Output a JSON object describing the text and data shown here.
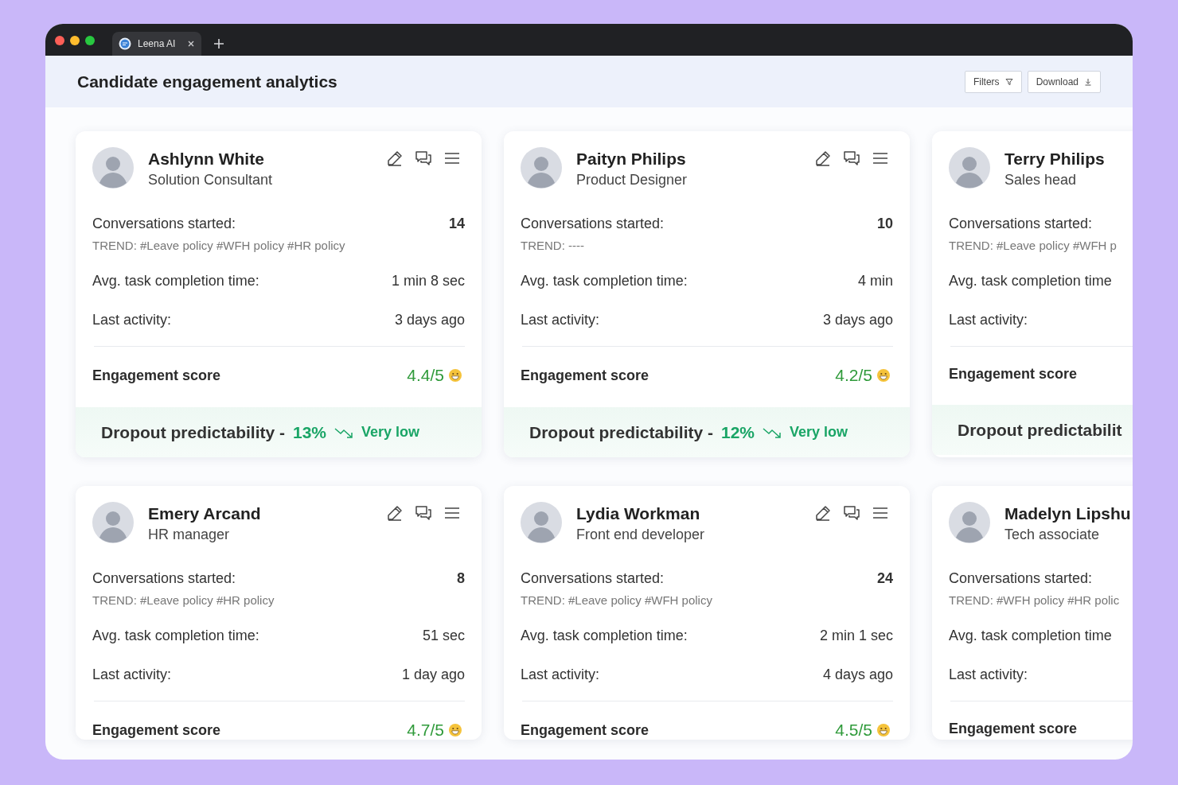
{
  "browser": {
    "tab_title": "Leena AI"
  },
  "header": {
    "title": "Candidate engagement analytics",
    "buttons": [
      "Filters",
      "Download"
    ]
  },
  "cards": [
    {
      "kind": "full",
      "name": "Ashlynn White",
      "role": "Solution Consultant",
      "conversations_label": "Conversations started:",
      "conversations_value": "14",
      "trend": "TREND: #Leave policy #WFH policy #HR policy",
      "avg_label": "Avg. task completion time:",
      "avg_value": "1 min 8 sec",
      "last_label": "Last activity:",
      "last_value": "3 days ago",
      "score_label": "Engagement score",
      "score": "4.4/5",
      "dropout": {
        "label": "Dropout predictability -",
        "percent": "13%",
        "rating": "Very low"
      }
    },
    {
      "kind": "full",
      "name": "Paityn Philips",
      "role": "Product Designer",
      "conversations_label": "Conversations started:",
      "conversations_value": "10",
      "trend": "TREND: ----",
      "avg_label": "Avg. task completion time:",
      "avg_value": "4 min",
      "last_label": "Last activity:",
      "last_value": "3 days ago",
      "score_label": "Engagement score",
      "score": "4.2/5",
      "dropout": {
        "label": "Dropout predictability -",
        "percent": "12%",
        "rating": "Very low"
      }
    },
    {
      "kind": "clipped",
      "name": "Terry Philips",
      "role": "Sales head",
      "conversations_label": "Conversations started:",
      "trend": "TREND: #Leave policy #WFH p",
      "avg_label": "Avg. task completion time",
      "last_label": "Last activity:",
      "score_label": "Engagement score",
      "dropout": {
        "label": "Dropout predictabilit"
      }
    },
    {
      "kind": "full",
      "name": "Emery Arcand",
      "role": "HR manager",
      "conversations_label": "Conversations started:",
      "conversations_value": "8",
      "trend": "TREND: #Leave policy #HR policy",
      "avg_label": "Avg. task completion time:",
      "avg_value": "51 sec",
      "last_label": "Last activity:",
      "last_value": "1 day ago",
      "score_label": "Engagement score",
      "score": "4.7/5"
    },
    {
      "kind": "full",
      "name": "Lydia Workman",
      "role": "Front end developer",
      "conversations_label": "Conversations started:",
      "conversations_value": "24",
      "trend": "TREND: #Leave policy #WFH policy",
      "avg_label": "Avg. task completion time:",
      "avg_value": "2 min 1 sec",
      "last_label": "Last activity:",
      "last_value": "4 days ago",
      "score_label": "Engagement score",
      "score": "4.5/5"
    },
    {
      "kind": "clipped",
      "name": "Madelyn Lipshu",
      "role": "Tech associate",
      "conversations_label": "Conversations started:",
      "trend": "TREND: #WFH policy #HR polic",
      "avg_label": "Avg. task completion time",
      "last_label": "Last activity:",
      "score_label": "Engagement score"
    }
  ]
}
